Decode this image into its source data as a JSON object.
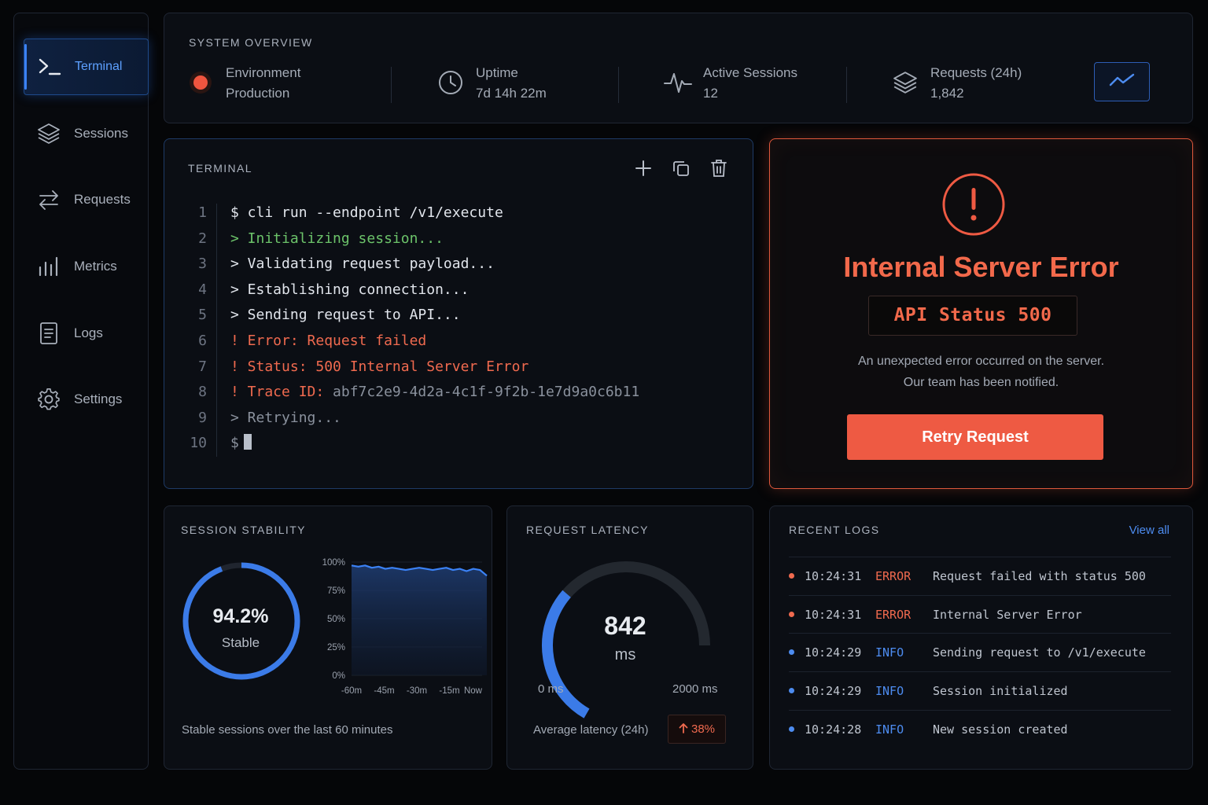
{
  "sidebar": {
    "items": [
      {
        "label": "Terminal",
        "icon": "terminal-icon",
        "active": true
      },
      {
        "label": "Sessions",
        "icon": "layers-icon"
      },
      {
        "label": "Requests",
        "icon": "arrows-exchange-icon"
      },
      {
        "label": "Metrics",
        "icon": "bar-chart-icon"
      },
      {
        "label": "Logs",
        "icon": "document-icon"
      },
      {
        "label": "Settings",
        "icon": "gear-icon"
      }
    ]
  },
  "overview": {
    "title": "SYSTEM OVERVIEW",
    "stats": [
      {
        "label": "Environment",
        "value": "Production",
        "icon": "status-dot-icon"
      },
      {
        "label": "Uptime",
        "value": "7d 14h 22m",
        "icon": "clock-icon"
      },
      {
        "label": "Active Sessions",
        "value": "12",
        "icon": "pulse-icon"
      },
      {
        "label": "Requests (24h)",
        "value": "1,842",
        "icon": "layers-icon"
      }
    ],
    "chart_button_icon": "trend-line-icon"
  },
  "terminal": {
    "title": "TERMINAL",
    "tools": [
      "plus-icon",
      "copy-icon",
      "trash-icon"
    ],
    "lines": [
      {
        "n": "1",
        "text": "$ cli run --endpoint /v1/execute",
        "style": "white"
      },
      {
        "n": "2",
        "text": "> Initializing session...",
        "style": "green"
      },
      {
        "n": "3",
        "text": "> Validating request payload...",
        "style": "white"
      },
      {
        "n": "4",
        "text": "> Establishing connection...",
        "style": "white"
      },
      {
        "n": "5",
        "text": "> Sending request to API...",
        "style": "white"
      },
      {
        "n": "6",
        "text": "! Error: Request failed",
        "style": "red"
      },
      {
        "n": "7",
        "text": "! Status: 500 Internal Server Error",
        "style": "red"
      },
      {
        "n": "8",
        "text_prefix": "! Trace ID: ",
        "text": "abf7c2e9-4d2a-4c1f-9f2b-1e7d9a0c6b11",
        "style": "trace"
      },
      {
        "n": "9",
        "text": "> Retrying...",
        "style": "dim"
      },
      {
        "n": "10",
        "text": "$",
        "style": "prompt"
      }
    ]
  },
  "error": {
    "title": "Internal Server Error",
    "status": "API Status 500",
    "message_line1": "An unexpected error occurred on the server.",
    "message_line2": "Our team has been notified.",
    "button": "Retry Request",
    "accent": "#ee5a43"
  },
  "stability": {
    "title": "SESSION STABILITY",
    "value": "94.2%",
    "value_fraction": 0.942,
    "label": "Stable",
    "footer": "Stable sessions over the last 60 minutes",
    "chart_data": {
      "type": "area",
      "x": [
        "-60m",
        "-45m",
        "-30m",
        "-15m",
        "Now"
      ],
      "y_ticks": [
        "100%",
        "75%",
        "50%",
        "25%",
        "0%"
      ],
      "ylim": [
        0,
        100
      ],
      "values": [
        97,
        96,
        97,
        95,
        96,
        94,
        95,
        94,
        93,
        94,
        95,
        94,
        93,
        94,
        95,
        93,
        94,
        92,
        94,
        93,
        88
      ],
      "color": "#3b82f6"
    }
  },
  "latency": {
    "title": "REQUEST LATENCY",
    "value": "842",
    "unit": "ms",
    "min_label": "0 ms",
    "max_label": "2000 ms",
    "min": 0,
    "max": 2000,
    "current": 842,
    "footer": "Average latency (24h)",
    "change": "38%",
    "change_icon": "arrow-up-icon"
  },
  "logs": {
    "title": "RECENT LOGS",
    "view_all": "View all",
    "rows": [
      {
        "time": "10:24:31",
        "level": "ERROR",
        "message": "Request failed with status 500"
      },
      {
        "time": "10:24:31",
        "level": "ERROR",
        "message": "Internal Server Error"
      },
      {
        "time": "10:24:29",
        "level": "INFO",
        "message": "Sending request to /v1/execute"
      },
      {
        "time": "10:24:29",
        "level": "INFO",
        "message": "Session initialized"
      },
      {
        "time": "10:24:28",
        "level": "INFO",
        "message": "New session created"
      }
    ],
    "colors": {
      "ERROR": "#f06a4f",
      "INFO": "#4d8cf0"
    }
  }
}
